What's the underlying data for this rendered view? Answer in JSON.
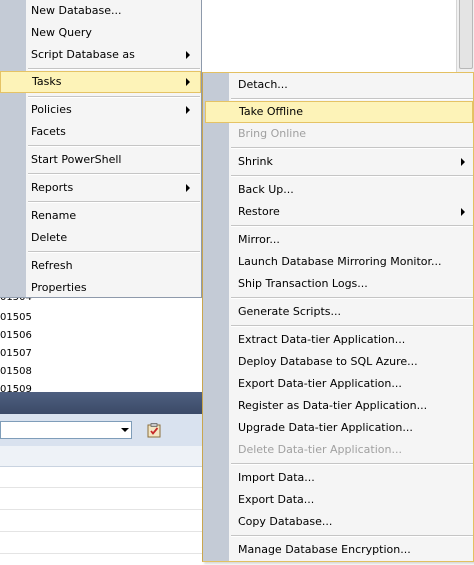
{
  "context_menu": {
    "items": [
      {
        "label": "New Database...",
        "submenu": false
      },
      {
        "label": "New Query",
        "submenu": false
      },
      {
        "label": "Script Database as",
        "submenu": true
      },
      {
        "label": "Tasks",
        "submenu": true,
        "selected": true
      },
      {
        "label": "Policies",
        "submenu": true
      },
      {
        "label": "Facets",
        "submenu": false
      },
      {
        "label": "Start PowerShell",
        "submenu": false
      },
      {
        "label": "Reports",
        "submenu": true
      },
      {
        "label": "Rename",
        "submenu": false
      },
      {
        "label": "Delete",
        "submenu": false
      },
      {
        "label": "Refresh",
        "submenu": false
      },
      {
        "label": "Properties",
        "submenu": false
      }
    ]
  },
  "tasks_menu": {
    "items": [
      {
        "label": "Detach...",
        "submenu": false,
        "disabled": false
      },
      {
        "label": "Take Offline",
        "submenu": false,
        "disabled": false,
        "highlighted": true
      },
      {
        "label": "Bring Online",
        "submenu": false,
        "disabled": true
      },
      {
        "label": "Shrink",
        "submenu": true,
        "disabled": false
      },
      {
        "label": "Back Up...",
        "submenu": false,
        "disabled": false
      },
      {
        "label": "Restore",
        "submenu": true,
        "disabled": false
      },
      {
        "label": "Mirror...",
        "submenu": false,
        "disabled": false
      },
      {
        "label": "Launch Database Mirroring Monitor...",
        "submenu": false,
        "disabled": false
      },
      {
        "label": "Ship Transaction Logs...",
        "submenu": false,
        "disabled": false
      },
      {
        "label": "Generate Scripts...",
        "submenu": false,
        "disabled": false
      },
      {
        "label": "Extract Data-tier Application...",
        "submenu": false,
        "disabled": false
      },
      {
        "label": "Deploy Database to SQL Azure...",
        "submenu": false,
        "disabled": false
      },
      {
        "label": "Export Data-tier Application...",
        "submenu": false,
        "disabled": false
      },
      {
        "label": "Register as Data-tier Application...",
        "submenu": false,
        "disabled": false
      },
      {
        "label": "Upgrade Data-tier Application...",
        "submenu": false,
        "disabled": false
      },
      {
        "label": "Delete Data-tier Application...",
        "submenu": false,
        "disabled": true
      },
      {
        "label": "Import Data...",
        "submenu": false,
        "disabled": false
      },
      {
        "label": "Export Data...",
        "submenu": false,
        "disabled": false
      },
      {
        "label": "Copy Database...",
        "submenu": false,
        "disabled": false
      },
      {
        "label": "Manage Database Encryption...",
        "submenu": false,
        "disabled": false
      }
    ]
  },
  "results": {
    "rows": [
      "01504",
      "01505",
      "01506",
      "01507",
      "01508",
      "01509"
    ]
  },
  "colors": {
    "highlight_fill": "#fdf3b8",
    "highlight_border": "#e5c365",
    "menu_gutter": "#c4cbd6",
    "dark_bar": "#3b4a67"
  },
  "icons": {
    "clipboard": "clipboard-check-icon",
    "combo_arrow": "chevron-down-icon",
    "submenu_arrow": "chevron-right-icon"
  }
}
